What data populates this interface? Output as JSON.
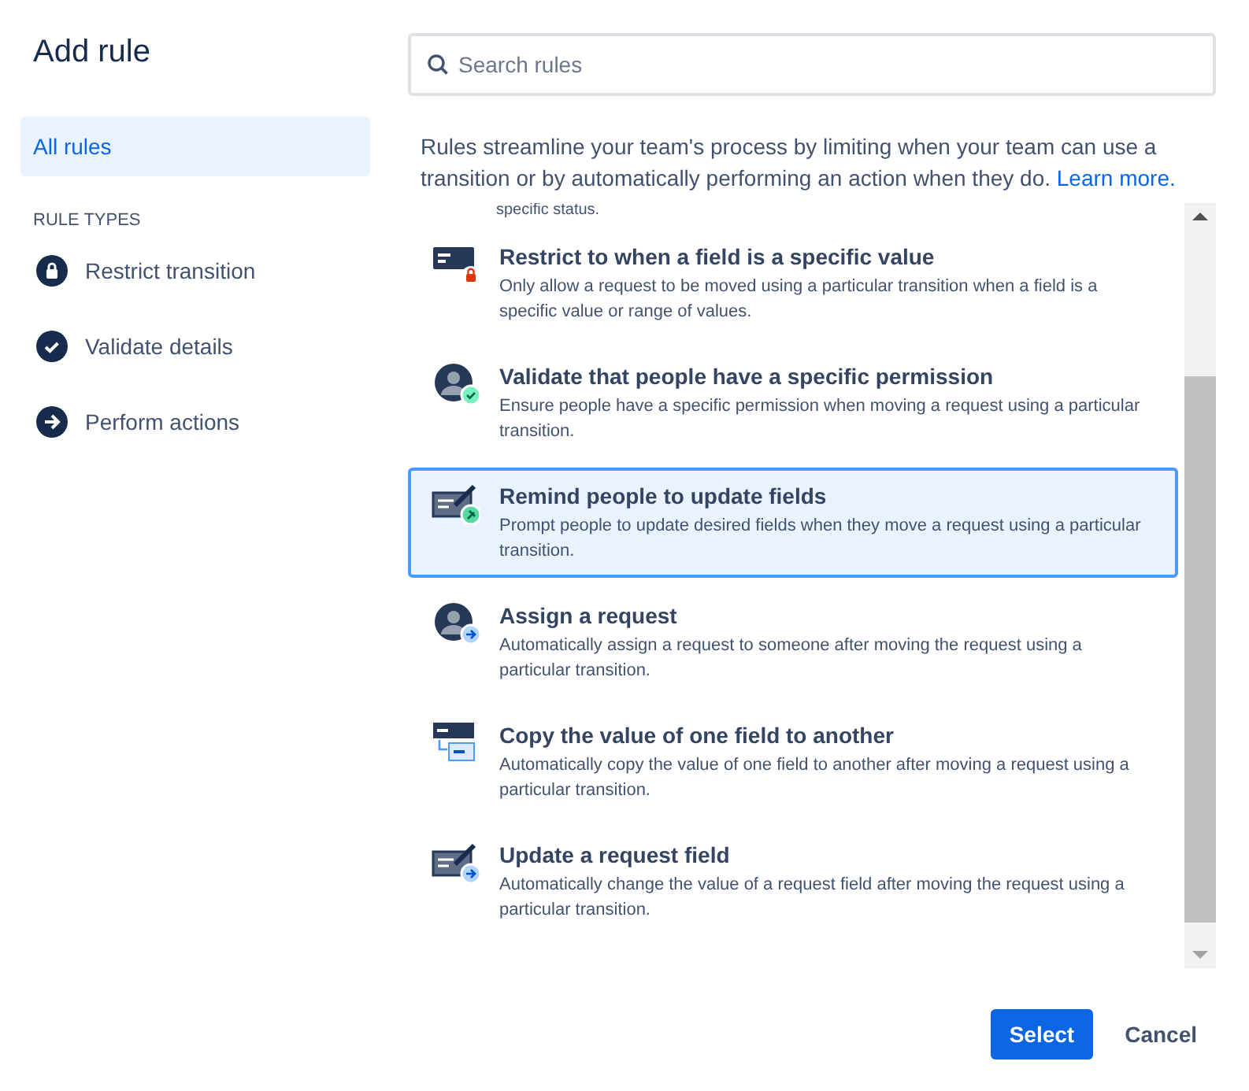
{
  "title": "Add rule",
  "sidebar": {
    "items": [
      {
        "label": "All rules",
        "selected": true
      }
    ],
    "section_heading": "RULE TYPES",
    "rule_types": [
      {
        "label": "Restrict transition",
        "kind": "lock"
      },
      {
        "label": "Validate details",
        "kind": "check"
      },
      {
        "label": "Perform actions",
        "kind": "arrow"
      }
    ]
  },
  "search": {
    "placeholder": "Search rules"
  },
  "intro": {
    "text": "Rules streamline your team's process by limiting when your team can use a transition or by automatically performing an action when they do.",
    "link": "Learn more."
  },
  "rules": {
    "partial_text": "specific status.",
    "items": [
      {
        "title": "Restrict to when a field is a specific value",
        "description": "Only allow a request to be moved using a particular transition when a field is a specific value or range of values.",
        "kind": "field-lock",
        "selected": false
      },
      {
        "title": "Validate that people have a specific permission",
        "description": "Ensure people have a specific permission when moving a request using a particular transition.",
        "kind": "person-check",
        "selected": false
      },
      {
        "title": "Remind people to update fields",
        "description": "Prompt people to update desired fields when they move a request using a particular transition.",
        "kind": "form-pin",
        "selected": true
      },
      {
        "title": "Assign a request",
        "description": "Automatically assign a request to someone after moving the request using a particular transition.",
        "kind": "person-arrow",
        "selected": false
      },
      {
        "title": "Copy the value of one field to another",
        "description": "Automatically copy the value of one field to another after moving a request using a particular transition.",
        "kind": "field-copy",
        "selected": false
      },
      {
        "title": "Update a request field",
        "description": "Automatically change the value of a request field after moving the request using a particular transition.",
        "kind": "form-arrow",
        "selected": false
      }
    ]
  },
  "buttons": {
    "primary": "Select",
    "secondary": "Cancel"
  }
}
